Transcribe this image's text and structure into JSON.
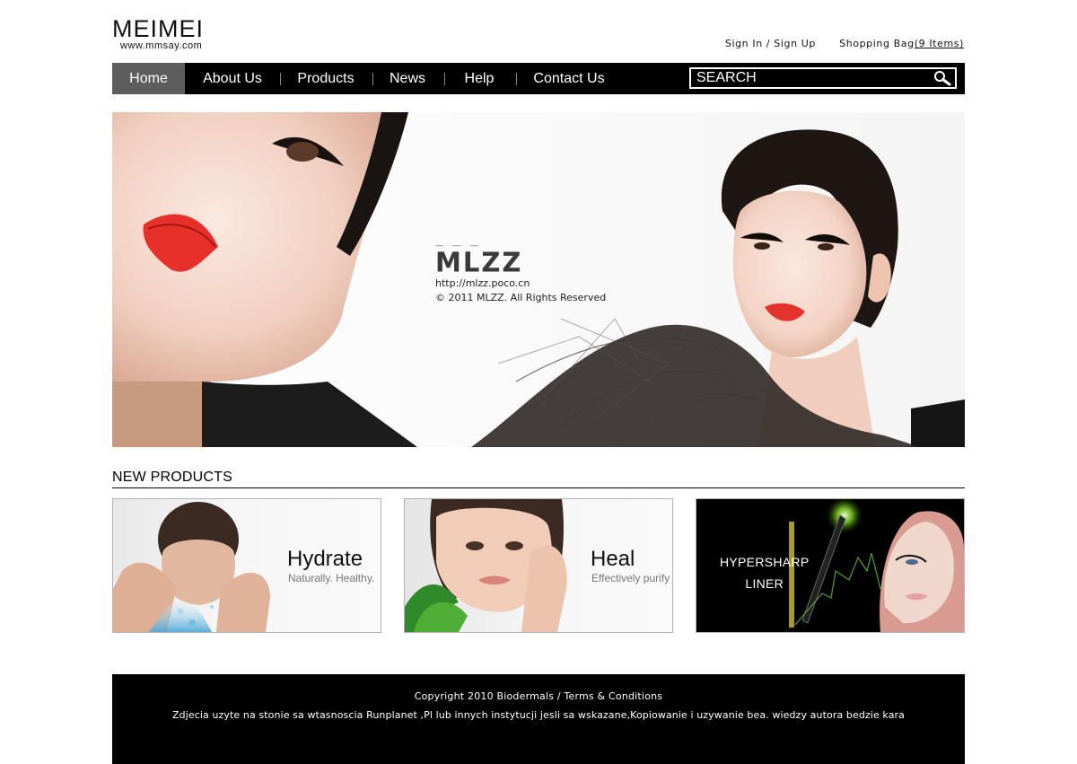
{
  "brand": {
    "name": "MEIMEI",
    "url": "www.mmsay.com"
  },
  "toplinks": {
    "sign_in": "Sign In / Sign Up",
    "bag_label": "Shopping Bag",
    "bag_count": "(9 Items)"
  },
  "nav": {
    "items": [
      {
        "label": "Home",
        "active": true
      },
      {
        "label": "About Us"
      },
      {
        "label": "Products"
      },
      {
        "label": "News"
      },
      {
        "label": "Help"
      },
      {
        "label": "Contact Us"
      }
    ],
    "search_placeholder": "SEARCH"
  },
  "hero": {
    "mark": "MLZZ",
    "url": "http://mlzz.poco.cn",
    "copyright": "©  2011 MLZZ. All Rights Reserved"
  },
  "new_products": {
    "title": "NEW PRODUCTS",
    "cards": [
      {
        "heading": "Hydrate",
        "sub": "Naturally. Healthy."
      },
      {
        "heading": "Heal",
        "sub": "Effectively purify"
      },
      {
        "line1": "HYPERSHARP",
        "line2": "LINER"
      }
    ]
  },
  "footer": {
    "line1": "Copyright 2010 Biodermals / Terms & Conditions",
    "line2": "Zdjecia uzyte na stonie sa wtasnoscia Runplanet ,Pl lub innych instytucji jesli sa wskazane,Kopiowanie i uzywanie bea. wiedzy autora bedzie kara"
  },
  "colors": {
    "nav_bg": "#000000",
    "nav_active": "#5d5d5d",
    "footer_bg": "#000000",
    "lip_red": "#e8302a"
  }
}
